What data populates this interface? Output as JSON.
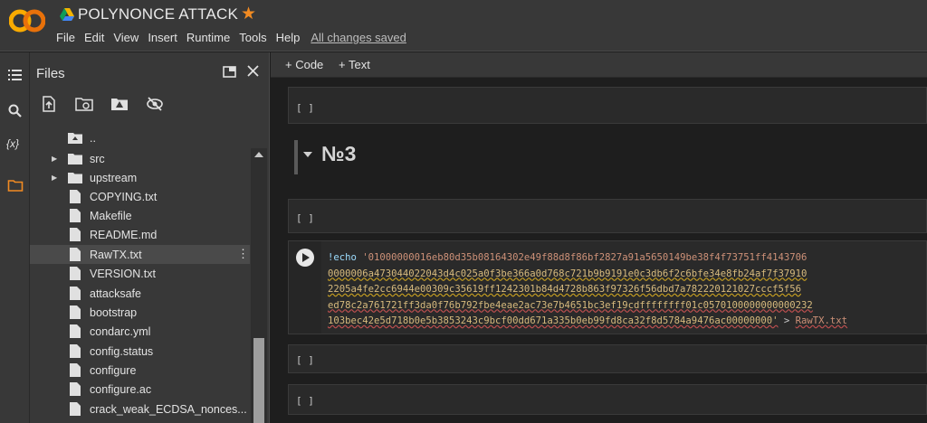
{
  "app": {
    "logo_text": "CO",
    "title": "POLYNONCE ATTACK",
    "star": "★",
    "accent_color": "#f28b22"
  },
  "menu": {
    "items": [
      "File",
      "Edit",
      "View",
      "Insert",
      "Runtime",
      "Tools",
      "Help"
    ],
    "save_status": "All changes saved"
  },
  "rail": {
    "icons": [
      "table-of-contents-icon",
      "search-icon",
      "variables-icon",
      "folder-icon"
    ],
    "variables_glyph": "{x}"
  },
  "files_panel": {
    "title": "Files",
    "tools": [
      "upload-icon",
      "refresh-folder-icon",
      "mount-drive-icon",
      "hide-files-icon"
    ],
    "parent_label": "..",
    "items": [
      {
        "name": "src",
        "type": "folder"
      },
      {
        "name": "upstream",
        "type": "folder"
      },
      {
        "name": "COPYING.txt",
        "type": "file"
      },
      {
        "name": "Makefile",
        "type": "file"
      },
      {
        "name": "README.md",
        "type": "file"
      },
      {
        "name": "RawTX.txt",
        "type": "file",
        "selected": true
      },
      {
        "name": "VERSION.txt",
        "type": "file"
      },
      {
        "name": "attacksafe",
        "type": "file"
      },
      {
        "name": "bootstrap",
        "type": "file"
      },
      {
        "name": "condarc.yml",
        "type": "file"
      },
      {
        "name": "config.status",
        "type": "file"
      },
      {
        "name": "configure",
        "type": "file"
      },
      {
        "name": "configure.ac",
        "type": "file"
      },
      {
        "name": "crack_weak_ECDSA_nonces...",
        "type": "file"
      }
    ]
  },
  "toolbar": {
    "add_code": "+ Code",
    "add_text": "+ Text"
  },
  "cells": {
    "empty_marker": "[ ]",
    "heading": "№3",
    "code": {
      "command": "!echo",
      "lines": [
        "'01000000016eb80d35b08164302e49f88d8f86bf2827a91a5650149be38f4f73751ff4143706",
        "0000006a473044022043d4c025a0f3be366a0d768c721b9b9191e0c3db6f2c6bfe34e8fb24af7f37910",
        "2205a4fe2cc6944e00309c35619ff1242301b84d4728b863f97326f56dbd7a782220121027cccf5f56",
        "ed78c2a761721ff3da0f76b792fbe4eae2ac73e7b4651bc3ef19cdffffffff01c0570100000000000232",
        "103bec42e5d718b0e5b3853243c9bcf00dd671a335b0eb99fd8ca32f8d5784a9476ac00000000'"
      ],
      "redirect": ">",
      "target_file": "RawTX.txt"
    }
  }
}
